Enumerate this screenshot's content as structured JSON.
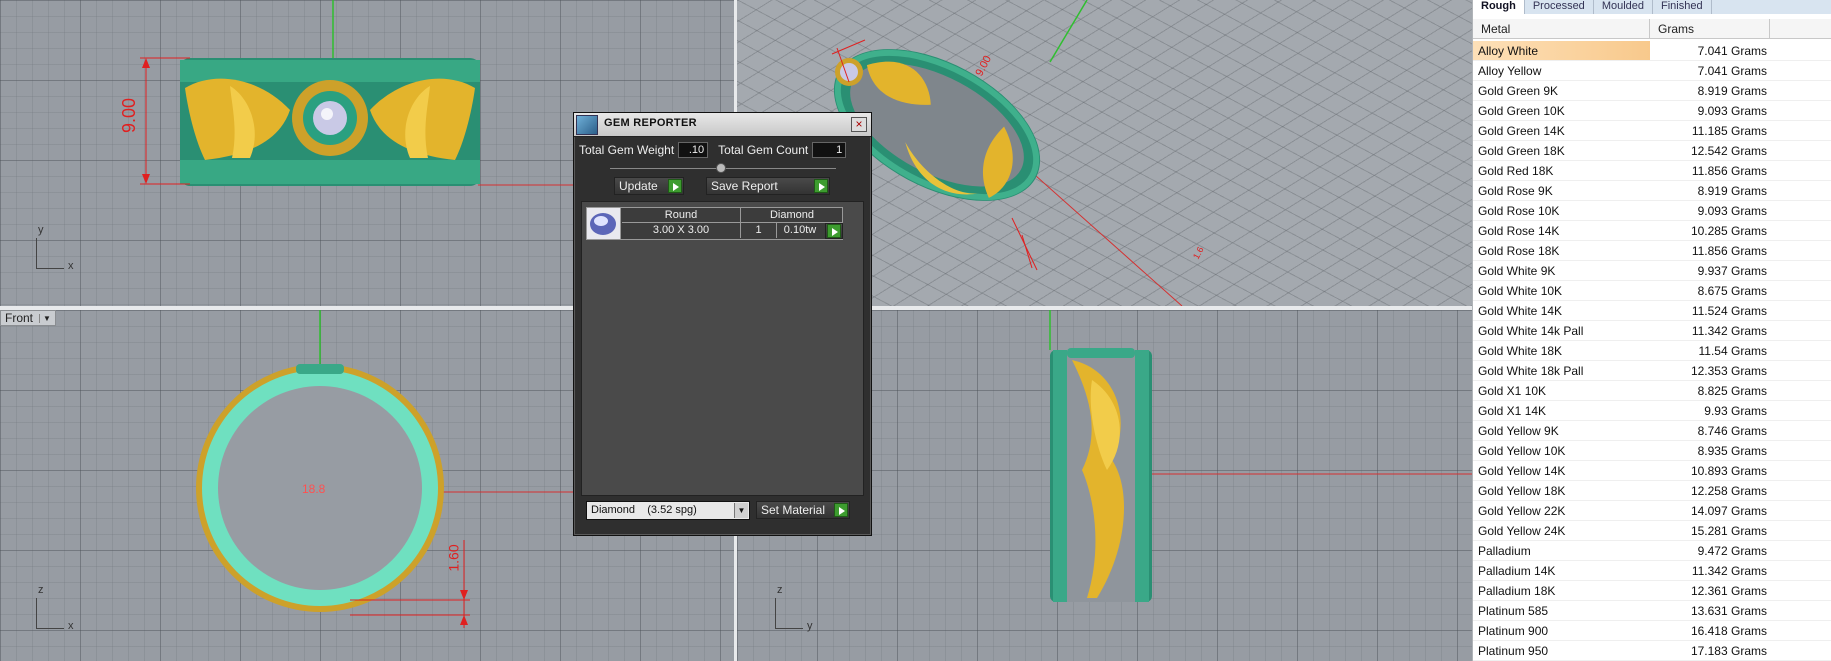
{
  "viewports": {
    "front_label": "Front",
    "top_dimension": "9.00",
    "persp_dimension_a": "9.00",
    "persp_dimension_b": "1.6",
    "front_dimension_ring": "18.8",
    "front_dimension_thickness": "1.60",
    "axis_top": {
      "v": "y",
      "h": "x"
    },
    "axis_front": {
      "v": "z",
      "h": "x"
    },
    "axis_right": {
      "v": "z",
      "h": "y"
    }
  },
  "gem_reporter": {
    "title": "GEM REPORTER",
    "close_glyph": "×",
    "total_weight_label": "Total Gem Weight",
    "total_weight_value": ".10",
    "total_count_label": "Total Gem Count",
    "total_count_value": "1",
    "update_label": "Update",
    "save_report_label": "Save Report",
    "gem": {
      "shape_header": "Round",
      "type_header": "Diamond",
      "size": "3.00 X 3.00",
      "count": "1",
      "weight": "0.10tw"
    },
    "material_value": "Diamond    (3.52 spg)",
    "set_material_label": "Set Material"
  },
  "metal_panel": {
    "tabs": [
      "Rough",
      "Processed",
      "Moulded",
      "Finished"
    ],
    "active_tab": "Rough",
    "col_metal": "Metal",
    "col_grams": "Grams",
    "rows": [
      {
        "name": "Alloy White",
        "grams": "7.041 Grams"
      },
      {
        "name": "Alloy Yellow",
        "grams": "7.041 Grams"
      },
      {
        "name": "Gold Green 9K",
        "grams": "8.919 Grams"
      },
      {
        "name": "Gold Green 10K",
        "grams": "9.093 Grams"
      },
      {
        "name": "Gold Green 14K",
        "grams": "11.185 Grams"
      },
      {
        "name": "Gold Green 18K",
        "grams": "12.542 Grams"
      },
      {
        "name": "Gold Red 18K",
        "grams": "11.856 Grams"
      },
      {
        "name": "Gold Rose 9K",
        "grams": "8.919 Grams"
      },
      {
        "name": "Gold Rose 10K",
        "grams": "9.093 Grams"
      },
      {
        "name": "Gold Rose 14K",
        "grams": "10.285 Grams"
      },
      {
        "name": "Gold Rose 18K",
        "grams": "11.856 Grams"
      },
      {
        "name": "Gold White 9K",
        "grams": "9.937 Grams"
      },
      {
        "name": "Gold White 10K",
        "grams": "8.675 Grams"
      },
      {
        "name": "Gold White 14K",
        "grams": "11.524 Grams"
      },
      {
        "name": "Gold White 14k Pall",
        "grams": "11.342 Grams"
      },
      {
        "name": "Gold White 18K",
        "grams": "11.54 Grams"
      },
      {
        "name": "Gold White 18k Pall",
        "grams": "12.353 Grams"
      },
      {
        "name": "Gold X1 10K",
        "grams": "8.825 Grams"
      },
      {
        "name": "Gold X1 14K",
        "grams": "9.93 Grams"
      },
      {
        "name": "Gold Yellow 9K",
        "grams": "8.746 Grams"
      },
      {
        "name": "Gold Yellow 10K",
        "grams": "8.935 Grams"
      },
      {
        "name": "Gold Yellow 14K",
        "grams": "10.893 Grams"
      },
      {
        "name": "Gold Yellow 18K",
        "grams": "12.258 Grams"
      },
      {
        "name": "Gold Yellow 22K",
        "grams": "14.097 Grams"
      },
      {
        "name": "Gold Yellow 24K",
        "grams": "15.281 Grams"
      },
      {
        "name": "Palladium",
        "grams": "9.472 Grams"
      },
      {
        "name": "Palladium 14K",
        "grams": "11.342 Grams"
      },
      {
        "name": "Palladium 18K",
        "grams": "12.361 Grams"
      },
      {
        "name": "Platinum 585",
        "grams": "13.631 Grams"
      },
      {
        "name": "Platinum 900",
        "grams": "16.418 Grams"
      },
      {
        "name": "Platinum 950",
        "grams": "17.183 Grams"
      }
    ]
  },
  "colors": {
    "ring_green": "#2f9a7c",
    "ring_gold": "#e8b82a",
    "dimension_red": "#e02020",
    "selected_row": "#f8c98c"
  }
}
